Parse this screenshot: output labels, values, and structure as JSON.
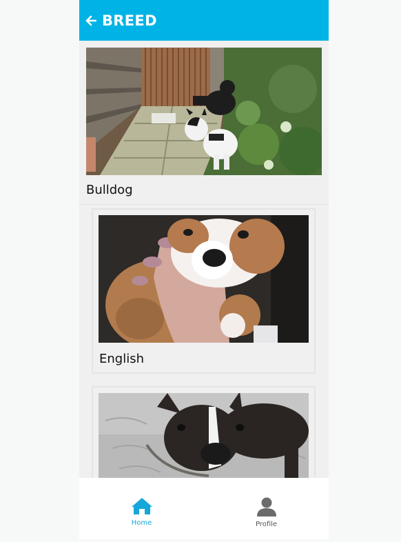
{
  "header": {
    "title": "BREED",
    "back_icon": "arrow-left-icon"
  },
  "colors": {
    "accent": "#00b3e6",
    "nav_active": "#14a7d9",
    "nav_inactive": "#555555"
  },
  "breed": {
    "label": "Bulldog"
  },
  "sub_breeds": [
    {
      "label": "English"
    },
    {
      "label": ""
    }
  ],
  "nav": {
    "home": {
      "label": "Home",
      "icon": "home-icon"
    },
    "profile": {
      "label": "Profile",
      "icon": "user-icon"
    }
  }
}
